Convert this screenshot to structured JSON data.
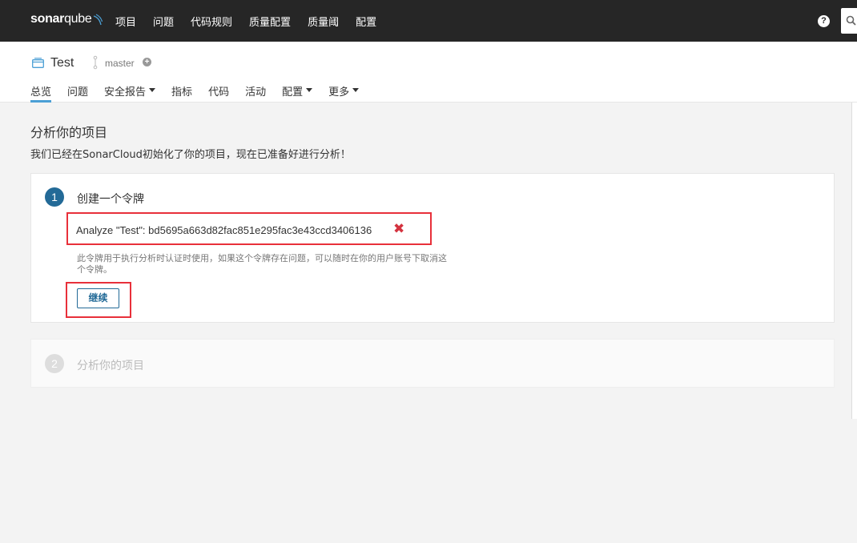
{
  "app": {
    "logo_text_bold": "sonar",
    "logo_text_light": "qube"
  },
  "topnav": {
    "items": [
      "项目",
      "问题",
      "代码规则",
      "质量配置",
      "质量阈",
      "配置"
    ],
    "help_icon": "question-circle-icon",
    "search_icon": "search-icon"
  },
  "project": {
    "name": "Test",
    "branch": "master",
    "tabs": [
      {
        "label": "总览",
        "active": true,
        "dropdown": false
      },
      {
        "label": "问题",
        "active": false,
        "dropdown": false
      },
      {
        "label": "安全报告",
        "active": false,
        "dropdown": true
      },
      {
        "label": "指标",
        "active": false,
        "dropdown": false
      },
      {
        "label": "代码",
        "active": false,
        "dropdown": false
      },
      {
        "label": "活动",
        "active": false,
        "dropdown": false
      },
      {
        "label": "配置",
        "active": false,
        "dropdown": true
      },
      {
        "label": "更多",
        "active": false,
        "dropdown": true
      }
    ]
  },
  "main": {
    "title": "分析你的项目",
    "description": "我们已经在SonarCloud初始化了你的项目，现在已准备好进行分析！"
  },
  "step1": {
    "number": "1",
    "title": "创建一个令牌",
    "token_label": "Analyze \"Test\": bd5695a663d82fac851e295fac3e43ccd3406136",
    "delete_icon": "close-icon",
    "help_text": "此令牌用于执行分析时认证时使用，如果这个令牌存在问题，可以随时在你的用户账号下取消这个令牌。",
    "continue_label": "继续"
  },
  "step2": {
    "number": "2",
    "title": "分析你的项目"
  },
  "colors": {
    "topbar": "#262626",
    "accent": "#236a97",
    "tab_underline": "#4b9fd5",
    "highlight": "#e8303a",
    "delete": "#d4333f"
  }
}
